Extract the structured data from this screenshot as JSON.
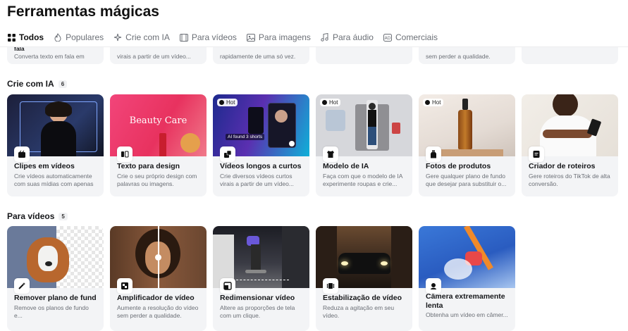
{
  "page_title": "Ferramentas mágicas",
  "tabs": [
    {
      "label": "Todos",
      "icon": "grid-icon",
      "active": true
    },
    {
      "label": "Populares",
      "icon": "flame-icon",
      "active": false
    },
    {
      "label": "Crie com IA",
      "icon": "sparkle-icon",
      "active": false
    },
    {
      "label": "Para vídeos",
      "icon": "film-icon",
      "active": false
    },
    {
      "label": "Para imagens",
      "icon": "image-icon",
      "active": false
    },
    {
      "label": "Para áudio",
      "icon": "music-icon",
      "active": false
    },
    {
      "label": "Comerciais",
      "icon": "ad-icon",
      "active": false
    }
  ],
  "top_row": [
    {
      "title": "fala",
      "desc": "Converta texto em fala em vá..."
    },
    {
      "title": "",
      "desc": "virais a partir de um vídeo..."
    },
    {
      "title": "",
      "desc": "rapidamente de uma só vez."
    },
    {
      "title": "",
      "desc": ""
    },
    {
      "title": "",
      "desc": "sem perder a qualidade."
    },
    {
      "title": "",
      "desc": ""
    }
  ],
  "sections": [
    {
      "title": "Crie com IA",
      "count": "6",
      "cards": [
        {
          "title": "Clipes em vídeos",
          "desc": "Crie vídeos automaticamente com suas mídias com apenas ...",
          "hot": ""
        },
        {
          "title": "Texto para design",
          "desc": "Crie o seu próprio design com palavras ou imagens.",
          "hot": "",
          "thumb_text": "Beauty Care"
        },
        {
          "title": "Vídeos longos a curtos",
          "desc": "Crie diversos vídeos curtos virais a partir de um vídeo...",
          "hot": "Hot",
          "thumb_text": "AI found 3 shorts"
        },
        {
          "title": "Modelo de IA",
          "desc": "Faça com que o modelo de IA experimente roupas e crie...",
          "hot": "Hot"
        },
        {
          "title": "Fotos de produtos",
          "desc": "Gere qualquer plano de fundo que desejar para substituir o...",
          "hot": "Hot"
        },
        {
          "title": "Criador de roteiros",
          "desc": "Gere roteiros do TikTok de alta conversão.",
          "hot": ""
        }
      ]
    },
    {
      "title": "Para vídeos",
      "count": "5",
      "cards": [
        {
          "title": "Remover plano de fundo",
          "desc": "Remove os planos de fundo e..."
        },
        {
          "title": "Amplificador de vídeo",
          "desc": "Aumente a resolução do vídeo sem perder a qualidade."
        },
        {
          "title": "Redimensionar vídeo",
          "desc": "Altere as proporções de tela com um clique."
        },
        {
          "title": "Estabilização de vídeo",
          "desc": "Reduza a agitação em seu vídeo."
        },
        {
          "title": "Câmera extremamente lenta",
          "desc": "Obtenha um vídeo em câmer..."
        }
      ]
    }
  ],
  "colors": {
    "accent_hot": "#111111",
    "card_bg": "#f3f4f6"
  }
}
